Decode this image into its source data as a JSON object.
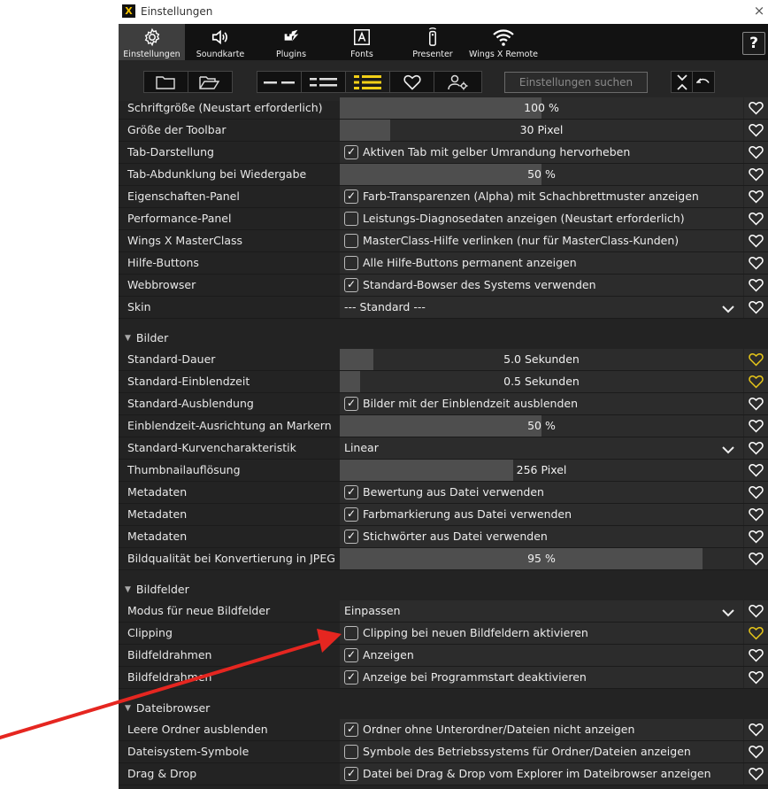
{
  "window": {
    "title": "Einstellungen",
    "close": "×",
    "logo": "X"
  },
  "toolbar": {
    "buttons": [
      {
        "label": "Einstellungen",
        "icon": "gear-icon",
        "active": true
      },
      {
        "label": "Soundkarte",
        "icon": "speaker-icon"
      },
      {
        "label": "Plugins",
        "icon": "plugin-icon"
      },
      {
        "label": "Fonts",
        "icon": "font-icon"
      },
      {
        "label": "Presenter",
        "icon": "presenter-icon"
      },
      {
        "label": "Wings X Remote",
        "icon": "wifi-icon"
      }
    ],
    "help": "?"
  },
  "filterbar": {
    "search_placeholder": "Einstellungen suchen"
  },
  "colors": {
    "fav_highlight": "#e6c619",
    "fav_normal": "#ffffff",
    "arrow": "#e52620"
  },
  "rows": [
    {
      "label": "Schriftgröße (Neustart erforderlich)",
      "type": "slider",
      "value": "100 %",
      "fill": 0.5
    },
    {
      "label": "Größe der Toolbar",
      "type": "slider",
      "value": "30 Pixel",
      "fill": 0.125
    },
    {
      "label": "Tab-Darstellung",
      "type": "check",
      "checked": true,
      "text": "Aktiven Tab mit gelber Umrandung hervorheben"
    },
    {
      "label": "Tab-Abdunklung bei Wiedergabe",
      "type": "slider",
      "value": "50 %",
      "fill": 0.5
    },
    {
      "label": "Eigenschaften-Panel",
      "type": "check",
      "checked": true,
      "text": "Farb-Transparenzen (Alpha) mit Schachbrettmuster anzeigen"
    },
    {
      "label": "Performance-Panel",
      "type": "check",
      "checked": false,
      "text": "Leistungs-Diagnosedaten anzeigen (Neustart erforderlich)"
    },
    {
      "label": "Wings X MasterClass",
      "type": "check",
      "checked": false,
      "text": "MasterClass-Hilfe verlinken (nur für MasterClass-Kunden)"
    },
    {
      "label": "Hilfe-Buttons",
      "type": "check",
      "checked": false,
      "text": "Alle Hilfe-Buttons permanent anzeigen"
    },
    {
      "label": "Webbrowser",
      "type": "check",
      "checked": true,
      "text": "Standard-Bowser des Systems verwenden"
    },
    {
      "label": "Skin",
      "type": "select",
      "text": "--- Standard ---"
    },
    {
      "type": "section",
      "label": "Bilder"
    },
    {
      "label": "Standard-Dauer",
      "type": "slider",
      "value": "5.0 Sekunden",
      "fill": 0.083,
      "fav": true
    },
    {
      "label": "Standard-Einblendzeit",
      "type": "slider",
      "value": "0.5 Sekunden",
      "fill": 0.05,
      "fav": true
    },
    {
      "label": "Standard-Ausblendung",
      "type": "check",
      "checked": true,
      "text": "Bilder mit der Einblendzeit ausblenden"
    },
    {
      "label": "Einblendzeit-Ausrichtung an Markern",
      "type": "slider",
      "value": "50 %",
      "fill": 0.5
    },
    {
      "label": "Standard-Kurvencharakteristik",
      "type": "select",
      "text": "Linear"
    },
    {
      "label": "Thumbnailauflösung",
      "type": "slider",
      "value": "256 Pixel",
      "fill": 0.43
    },
    {
      "label": "Metadaten",
      "type": "check",
      "checked": true,
      "text": "Bewertung aus Datei verwenden"
    },
    {
      "label": "Metadaten",
      "type": "check",
      "checked": true,
      "text": "Farbmarkierung aus Datei verwenden"
    },
    {
      "label": "Metadaten",
      "type": "check",
      "checked": true,
      "text": "Stichwörter aus Datei verwenden"
    },
    {
      "label": "Bildqualität bei Konvertierung in JPEG",
      "type": "slider",
      "value": "95 %",
      "fill": 0.9
    },
    {
      "type": "section",
      "label": "Bildfelder"
    },
    {
      "label": "Modus für neue Bildfelder",
      "type": "select",
      "text": "Einpassen"
    },
    {
      "label": "Clipping",
      "type": "check",
      "checked": false,
      "text": "Clipping bei neuen Bildfeldern aktivieren",
      "fav": true
    },
    {
      "label": "Bildfeldrahmen",
      "type": "check",
      "checked": true,
      "text": "Anzeigen"
    },
    {
      "label": "Bildfeldrahmen",
      "type": "check",
      "checked": true,
      "text": "Anzeige bei Programmstart deaktivieren"
    },
    {
      "type": "section",
      "label": "Dateibrowser"
    },
    {
      "label": "Leere Ordner ausblenden",
      "type": "check",
      "checked": true,
      "text": "Ordner ohne Unterordner/Dateien nicht anzeigen"
    },
    {
      "label": "Dateisystem-Symbole",
      "type": "check",
      "checked": false,
      "text": "Symbole des Betriebssystems für Ordner/Dateien anzeigen"
    },
    {
      "label": "Drag & Drop",
      "type": "check",
      "checked": true,
      "text": "Datei bei Drag & Drop vom Explorer im Dateibrowser anzeigen"
    }
  ]
}
